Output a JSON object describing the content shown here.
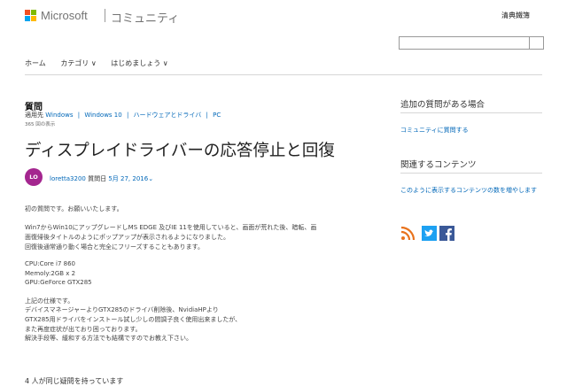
{
  "header": {
    "brand": "Microsoft",
    "site": "コミュニティ",
    "signin_label": "清典鐵簿",
    "search": {
      "placeholder": ""
    }
  },
  "nav": {
    "items": [
      "ホーム",
      "カテゴリ ∨",
      "はじめましょう ∨"
    ]
  },
  "question": {
    "type_label": "質問",
    "applies_prefix": "適用先",
    "applies": [
      "Windows",
      "Windows 10",
      "ハードウェアとドライバ",
      "PC"
    ],
    "views": "365 回の表示",
    "title": "ディスプレイドライバーの応答停止と回復",
    "avatar_initials": "LO",
    "author": "loretta3200",
    "asked_label": "質問日",
    "date": "5月 27, 2016",
    "body": [
      "初の質問です。お願いいたします。",
      "Win7からWin10にアップグレードしMS EDGE 及びIE 11を使用していると、画面が荒れた後、暗転、画",
      "面復帰後タイトルのようにポップアップが表示されるようになりました。",
      "回復後通常通り動く場合と完全にフリーズすることもあります。",
      "CPU:Core i7 860",
      "Memoly:2GB x 2",
      "GPU:GeForce GTX285",
      "上記の仕様です。",
      "デバイスマネージャーよりGTX285のドライバ削除後、NvidiaHPより",
      "GTX285用ドライバをインストール試し少しの間調子良く使用出来ましたが、",
      "また再度症状が出ており困っております。",
      "解決手段等、緩和する方法でも結構ですのでお教え下さい。"
    ],
    "same_question": "4 人が同じ疑問を持っています"
  },
  "sidebar": {
    "heading1": "追加の質問がある場合",
    "link1": "コミュニティに質問する",
    "heading2": "関連するコンテンツ",
    "link2": "このように表示するコンテンツの数を増やします",
    "social": [
      "rss-icon",
      "twitter-icon",
      "facebook-icon"
    ]
  },
  "colors": {
    "link": "#0067b8",
    "avatar": "#a4268f"
  }
}
